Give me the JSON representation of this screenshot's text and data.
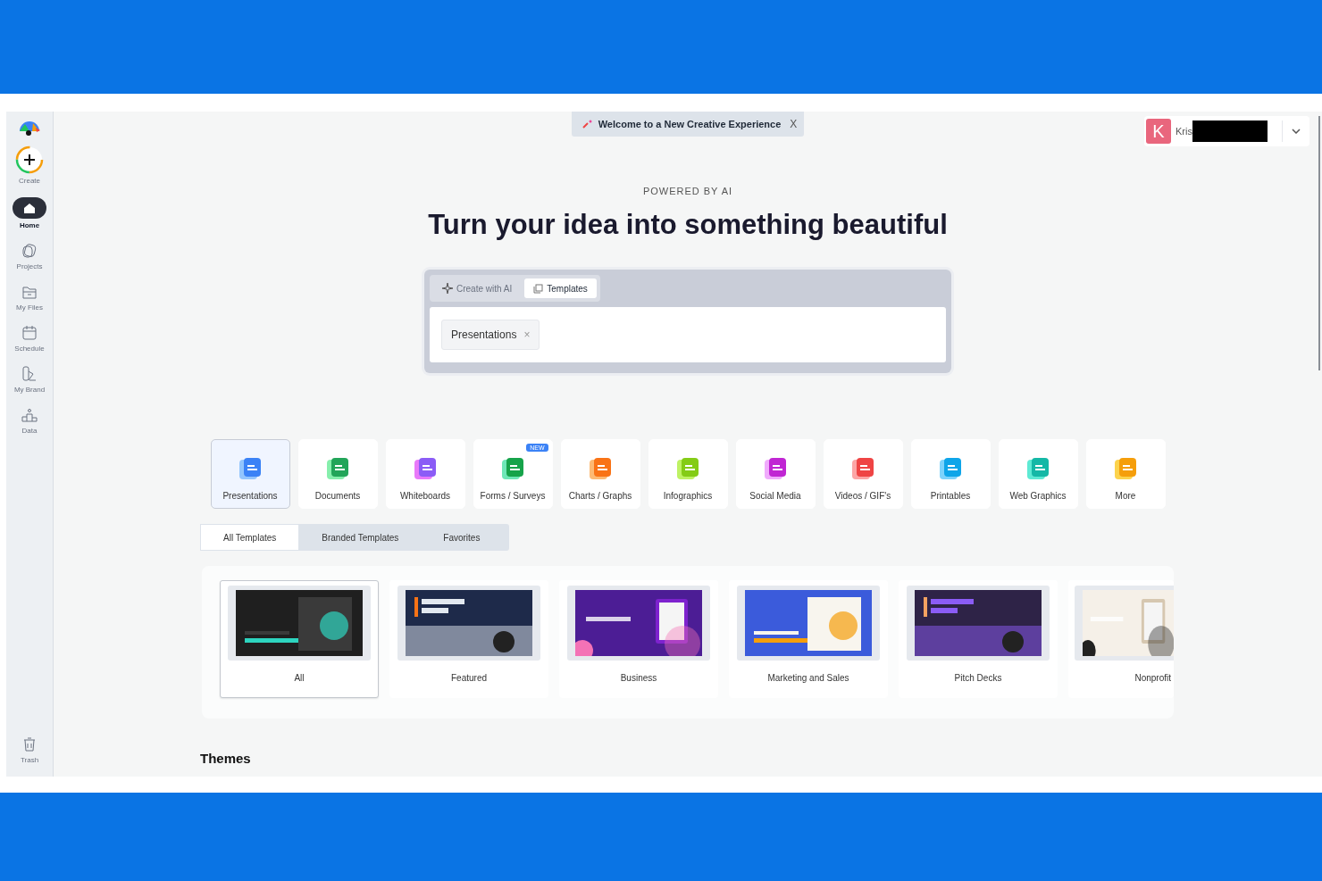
{
  "sidebar": {
    "items": [
      {
        "label": "Create",
        "kind": "create",
        "selected": false
      },
      {
        "label": "Home",
        "kind": "home",
        "selected": true
      },
      {
        "label": "Projects",
        "kind": "projects",
        "selected": false
      },
      {
        "label": "My Files",
        "kind": "files",
        "selected": false
      },
      {
        "label": "Schedule",
        "kind": "schedule",
        "selected": false
      },
      {
        "label": "My Brand",
        "kind": "brand",
        "selected": false
      },
      {
        "label": "Data",
        "kind": "data",
        "selected": false
      }
    ],
    "bottom_item": {
      "label": "Trash"
    }
  },
  "banner": {
    "text": "Welcome to a New Creative Experience",
    "close": "X"
  },
  "account": {
    "initial": "K",
    "name": "Kris"
  },
  "eyebrow": "POWERED BY AI",
  "heading": "Turn your idea into something beautiful",
  "mode_tabs": [
    {
      "label": "Create with AI",
      "kind": "ai",
      "selected": false
    },
    {
      "label": "Templates",
      "kind": "templates",
      "selected": true
    }
  ],
  "search": {
    "chip": "Presentations",
    "chip_close": "×"
  },
  "categories": [
    {
      "label": "Presentations",
      "selected": true
    },
    {
      "label": "Documents",
      "selected": false
    },
    {
      "label": "Whiteboards",
      "selected": false
    },
    {
      "label": "Forms / Surveys",
      "selected": false,
      "badge": "NEW"
    },
    {
      "label": "Charts / Graphs",
      "selected": false
    },
    {
      "label": "Infographics",
      "selected": false
    },
    {
      "label": "Social Media",
      "selected": false
    },
    {
      "label": "Videos / GIF's",
      "selected": false
    },
    {
      "label": "Printables",
      "selected": false
    },
    {
      "label": "Web Graphics",
      "selected": false
    },
    {
      "label": "More",
      "selected": false
    }
  ],
  "filter_tabs": [
    {
      "label": "All Templates",
      "selected": true
    },
    {
      "label": "Branded Templates",
      "selected": false
    },
    {
      "label": "Favorites",
      "selected": false
    }
  ],
  "template_groups": [
    {
      "label": "All",
      "selected": true
    },
    {
      "label": "Featured",
      "selected": false
    },
    {
      "label": "Business",
      "selected": false
    },
    {
      "label": "Marketing and Sales",
      "selected": false
    },
    {
      "label": "Pitch Decks",
      "selected": false
    },
    {
      "label": "Nonprofit",
      "selected": false
    }
  ],
  "section_title": "Themes"
}
